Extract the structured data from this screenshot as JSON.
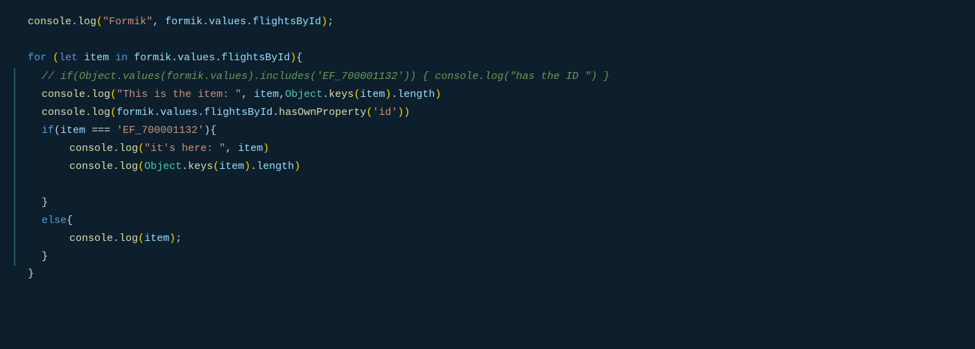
{
  "editor": {
    "background": "#0d1f2d",
    "lines": [
      {
        "id": "line1",
        "indent": 1,
        "bar": false,
        "content": "console.log(\"Formik\", formik.values.flightsById);"
      },
      {
        "id": "line2",
        "indent": 0,
        "bar": false,
        "content": ""
      },
      {
        "id": "line3",
        "indent": 1,
        "bar": false,
        "content": "for (let item in formik.values.flightsById){"
      },
      {
        "id": "line4",
        "indent": 2,
        "bar": true,
        "content": "// if(Object.values(formik.values).includes('EF_700001132')) { console.log(\"has the ID \") }"
      },
      {
        "id": "line5",
        "indent": 2,
        "bar": true,
        "content": "console.log(\"This is the item: \", item,Object.keys(item).length)"
      },
      {
        "id": "line6",
        "indent": 2,
        "bar": true,
        "content": "console.log(formik.values.flightsById.hasOwnProperty('id'))"
      },
      {
        "id": "line7",
        "indent": 2,
        "bar": true,
        "content": "if(item === 'EF_700001132'){"
      },
      {
        "id": "line8",
        "indent": 3,
        "bar": true,
        "content": "console.log(\"it's here: \", item)"
      },
      {
        "id": "line9",
        "indent": 3,
        "bar": true,
        "content": "console.log(Object.keys(item).length)"
      },
      {
        "id": "line10",
        "indent": 2,
        "bar": true,
        "content": ""
      },
      {
        "id": "line11",
        "indent": 2,
        "bar": true,
        "content": "}"
      },
      {
        "id": "line12",
        "indent": 2,
        "bar": true,
        "content": "else{"
      },
      {
        "id": "line13",
        "indent": 3,
        "bar": true,
        "content": "console.log(item);"
      },
      {
        "id": "line14",
        "indent": 2,
        "bar": true,
        "content": "}"
      },
      {
        "id": "line15",
        "indent": 1,
        "bar": false,
        "content": "}"
      }
    ]
  }
}
